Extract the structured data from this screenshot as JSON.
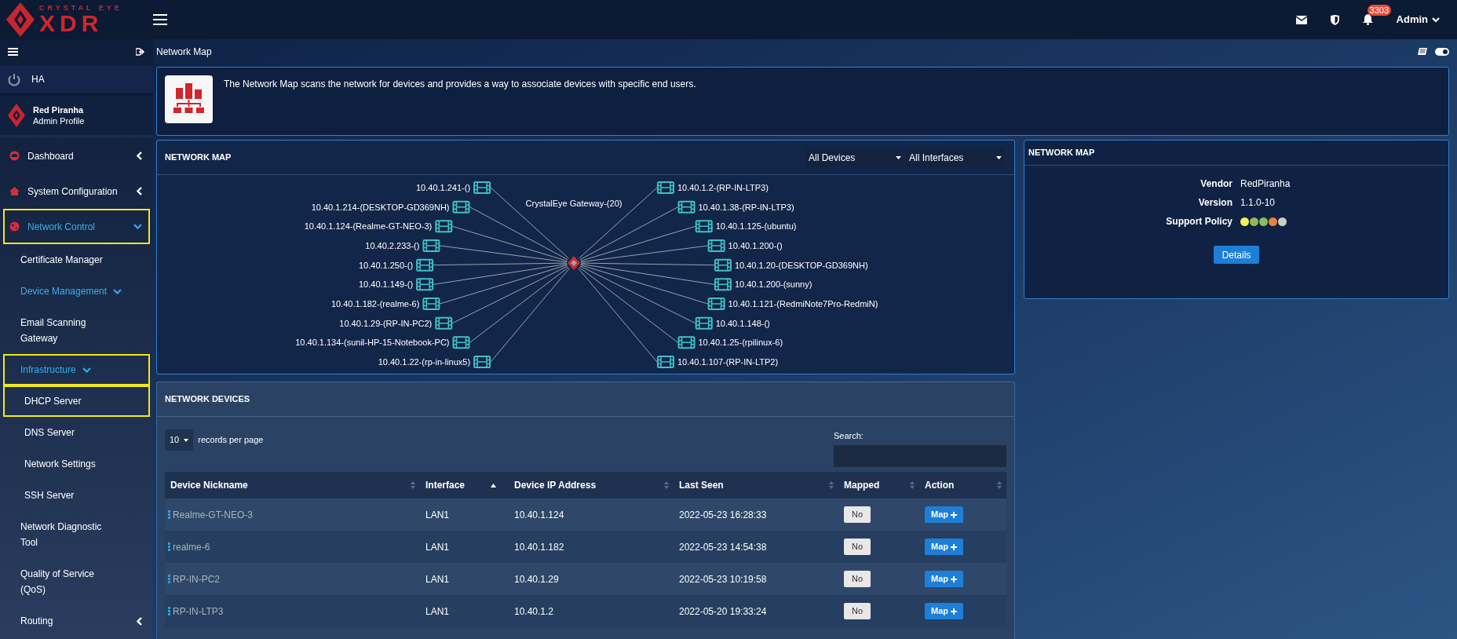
{
  "header": {
    "logo": {
      "tagline": "CRYSTAL EYE",
      "name": "XDR"
    },
    "notification_count": "3303",
    "user": "Admin"
  },
  "sidebar": {
    "ha": "HA",
    "profile": {
      "name": "Red Piranha",
      "role": "Admin Profile"
    },
    "items": [
      {
        "label": "Dashboard",
        "active": false,
        "highlighted": false,
        "expanded": false
      },
      {
        "label": "System Configuration",
        "active": false,
        "highlighted": false,
        "expanded": false
      },
      {
        "label": "Network Control",
        "active": true,
        "highlighted": true,
        "expanded": true,
        "children": [
          {
            "label": "Certificate Manager",
            "active": false,
            "highlighted": false
          },
          {
            "label": "Device Management",
            "active": true,
            "highlighted": false,
            "expanded": true
          },
          {
            "label": "Email Scanning Gateway",
            "active": false,
            "highlighted": false
          },
          {
            "label": "Infrastructure",
            "active": true,
            "highlighted": true,
            "expanded": true,
            "children": [
              {
                "label": "DHCP Server",
                "active": false,
                "highlighted": true
              },
              {
                "label": "DNS Server",
                "active": false,
                "highlighted": false
              },
              {
                "label": "Network Settings",
                "active": false,
                "highlighted": false
              },
              {
                "label": "SSH Server",
                "active": false,
                "highlighted": false
              }
            ]
          },
          {
            "label": "Network Diagnostic Tool",
            "active": false,
            "highlighted": false
          },
          {
            "label": "Quality of Service (QoS)",
            "active": false,
            "highlighted": false
          },
          {
            "label": "Routing",
            "active": false,
            "highlighted": false,
            "expanded": false
          }
        ]
      }
    ]
  },
  "page_title": "Network Map",
  "page_toggle": {
    "on": true
  },
  "intro": "The Network Map scans the network for devices and provides a way to associate devices with specific end users.",
  "map_panel": {
    "title": "NETWORK MAP",
    "filters": [
      "All Devices",
      "All Interfaces"
    ],
    "gateway": "CrystalEye Gateway-(20)",
    "devices": [
      "10.40.1.241-()",
      "10.40.1.2-(RP-IN-LTP3)",
      "10.40.1.214-(DESKTOP-GD369NH)",
      "10.40.1.38-(RP-IN-LTP3)",
      "10.40.1.124-(Realme-GT-NEO-3)",
      "10.40.1.125-(ubuntu)",
      "10.40.2.233-()",
      "10.40.1.200-()",
      "10.40.1.250-()",
      "10.40.1.20-(DESKTOP-GD369NH)",
      "10.40.1.149-()",
      "10.40.1.200-(sunny)",
      "10.40.1.182-(realme-6)",
      "10.40.1.121-(RedmiNote7Pro-RedmiN)",
      "10.40.1.29-(RP-IN-PC2)",
      "10.40.1.148-()",
      "10.40.1.134-(sunil-HP-15-Notebook-PC)",
      "10.40.1.25-(rpilinux-6)",
      "10.40.1.22-(rp-in-linux5)",
      "10.40.1.107-(RP-IN-LTP2)"
    ]
  },
  "info_panel": {
    "title": "NETWORK MAP",
    "fields": [
      {
        "label": "Vendor",
        "value": "RedPiranha"
      },
      {
        "label": "Version",
        "value": "1.1.0-10"
      }
    ],
    "support_policy": {
      "label": "Support Policy",
      "dots": [
        {
          "color": "#f4f05c"
        },
        {
          "color": "#8fba5c"
        },
        {
          "color": "#8fba5c"
        },
        {
          "color": "#e8843a"
        },
        {
          "color": "#cccccc"
        }
      ]
    },
    "button": "Details"
  },
  "devices_panel": {
    "title": "NETWORK DEVICES",
    "page_size": "10",
    "page_size_label": "records per page",
    "search_label": "Search:",
    "columns": [
      {
        "label": "Device Nickname",
        "sorted": false
      },
      {
        "label": "Interface",
        "sorted": true
      },
      {
        "label": "Device IP Address",
        "sorted": false
      },
      {
        "label": "Last Seen",
        "sorted": false
      },
      {
        "label": "Mapped",
        "sorted": false
      },
      {
        "label": "Action",
        "sorted": false
      }
    ],
    "rows": [
      {
        "nickname": "Realme-GT-NEO-3",
        "interface": "LAN1",
        "ip": "10.40.1.124",
        "last_seen": "2022-05-23 16:28:33",
        "mapped": "No",
        "action": "Map"
      },
      {
        "nickname": "realme-6",
        "interface": "LAN1",
        "ip": "10.40.1.182",
        "last_seen": "2022-05-23 14:54:38",
        "mapped": "No",
        "action": "Map"
      },
      {
        "nickname": "RP-IN-PC2",
        "interface": "LAN1",
        "ip": "10.40.1.29",
        "last_seen": "2022-05-23 10:19:58",
        "mapped": "No",
        "action": "Map"
      },
      {
        "nickname": "RP-IN-LTP3",
        "interface": "LAN1",
        "ip": "10.40.1.2",
        "last_seen": "2022-05-20 19:33:24",
        "mapped": "No",
        "action": "Map"
      }
    ]
  }
}
